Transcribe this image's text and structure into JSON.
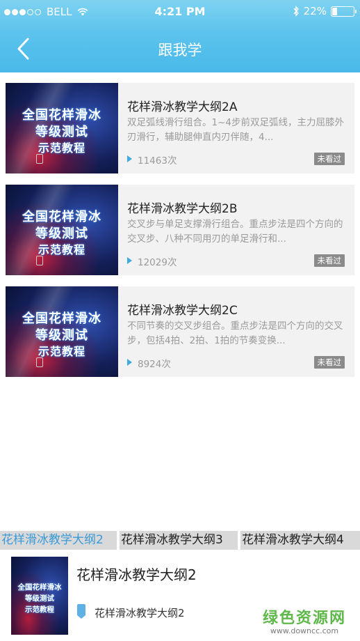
{
  "status_bar": {
    "carrier": "BELL",
    "time": "4:21 PM",
    "battery_percent": "22%",
    "battery_level": 0.22
  },
  "nav": {
    "title": "跟我学"
  },
  "videos": [
    {
      "title": "花样滑冰教学大纲2A",
      "description": "双足弧线滑行组合。1~4步前双足弧线，主力屈膝外刃滑行，辅助腿伸直内刃伴随，4...",
      "count": "11463次",
      "badge": "未看过",
      "thumb_lines": [
        "全国花样滑冰",
        "等级测试",
        "示范教程"
      ]
    },
    {
      "title": "花样滑冰教学大纲2B",
      "description": "交叉步与单足支撑滑行组合。重点步法是四个方向的交叉步、八种不同用刃的单足滑行和...",
      "count": "12029次",
      "badge": "未看过",
      "thumb_lines": [
        "全国花样滑冰",
        "等级测试",
        "示范教程"
      ]
    },
    {
      "title": "花样滑冰教学大纲2C",
      "description": "不同节奏的交叉步组合。重点步法是四个方向的交叉步，包括4拍、2拍、1拍的节奏变换...",
      "count": "8924次",
      "badge": "未看过",
      "thumb_lines": [
        "全国花样滑冰",
        "等级测试",
        "示范教程"
      ]
    }
  ],
  "tabs": [
    {
      "label": "花样滑冰教学大纲2",
      "active": true
    },
    {
      "label": "花样滑冰教学大纲3",
      "active": false
    },
    {
      "label": "花样滑冰教学大纲4",
      "active": false
    }
  ],
  "player": {
    "title": "花样滑冰教学大纲2",
    "subtitle": "花样滑冰教学大纲2",
    "thumb_lines": [
      "全国花样滑冰",
      "等级测试",
      "示范教程"
    ]
  },
  "watermark": {
    "main": "绿色资源网",
    "url": "www.downcc.com"
  },
  "colors": {
    "header_gradient_top": "#7fd2f0",
    "header_gradient_bottom": "#49b9ea",
    "accent_blue": "#41a9e0",
    "active_tab_text": "#3a9ad8",
    "badge_bg": "#8a8a8a",
    "watermark_green": "#5fb84a"
  }
}
